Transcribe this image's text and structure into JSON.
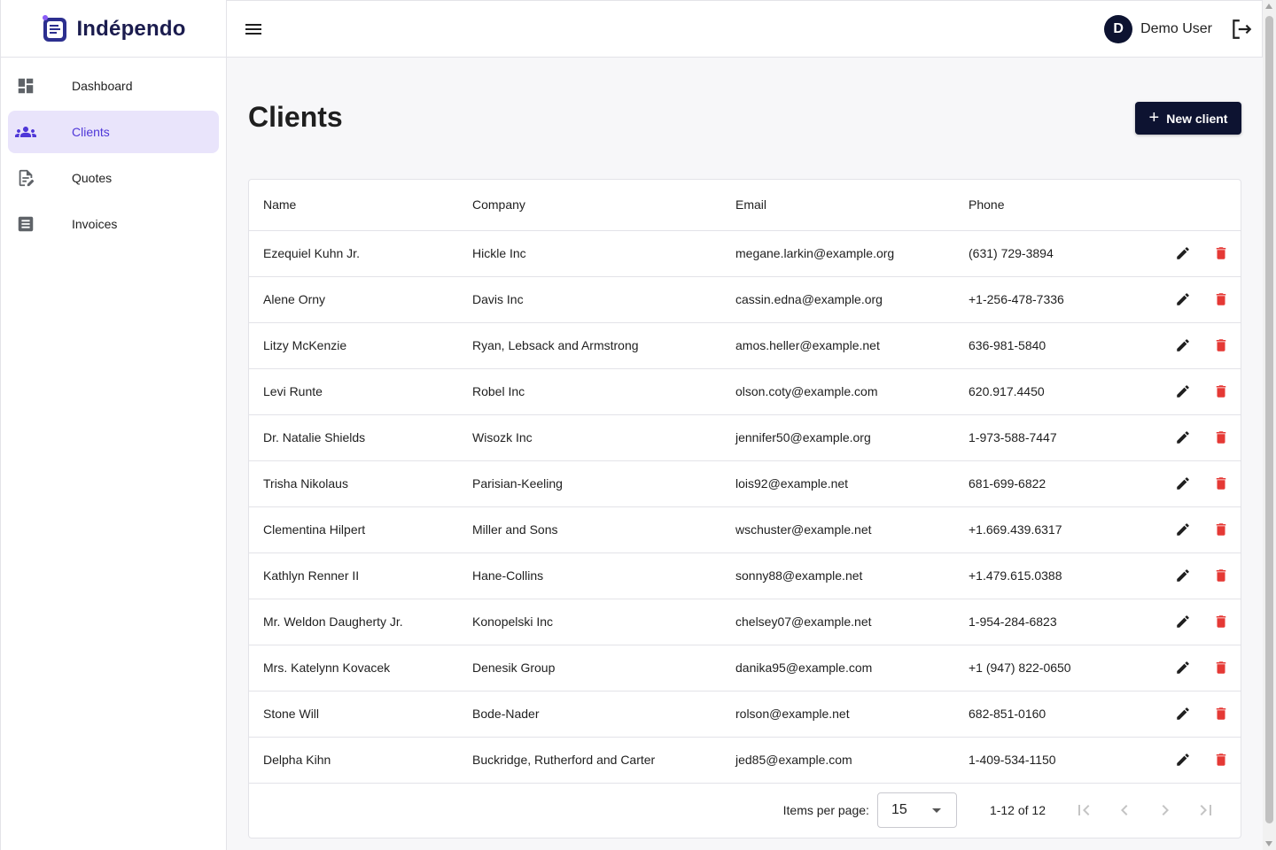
{
  "brand": {
    "name": "Indépendo"
  },
  "sidebar": {
    "items": [
      {
        "label": "Dashboard",
        "icon": "dashboard-icon",
        "active": false
      },
      {
        "label": "Clients",
        "icon": "people-icon",
        "active": true
      },
      {
        "label": "Quotes",
        "icon": "edit-document-icon",
        "active": false
      },
      {
        "label": "Invoices",
        "icon": "receipt-icon",
        "active": false
      }
    ]
  },
  "header": {
    "user": {
      "initial": "D",
      "name": "Demo User"
    }
  },
  "page": {
    "title": "Clients",
    "new_button_label": "New client"
  },
  "table": {
    "columns": [
      "Name",
      "Company",
      "Email",
      "Phone"
    ],
    "rows": [
      {
        "name": "Ezequiel Kuhn Jr.",
        "company": "Hickle Inc",
        "email": "megane.larkin@example.org",
        "phone": "(631) 729-3894"
      },
      {
        "name": "Alene Orny",
        "company": "Davis Inc",
        "email": "cassin.edna@example.org",
        "phone": "+1-256-478-7336"
      },
      {
        "name": "Litzy McKenzie",
        "company": "Ryan, Lebsack and Armstrong",
        "email": "amos.heller@example.net",
        "phone": "636-981-5840"
      },
      {
        "name": "Levi Runte",
        "company": "Robel Inc",
        "email": "olson.coty@example.com",
        "phone": "620.917.4450"
      },
      {
        "name": "Dr. Natalie Shields",
        "company": "Wisozk Inc",
        "email": "jennifer50@example.org",
        "phone": "1-973-588-7447"
      },
      {
        "name": "Trisha Nikolaus",
        "company": "Parisian-Keeling",
        "email": "lois92@example.net",
        "phone": "681-699-6822"
      },
      {
        "name": "Clementina Hilpert",
        "company": "Miller and Sons",
        "email": "wschuster@example.net",
        "phone": "+1.669.439.6317"
      },
      {
        "name": "Kathlyn Renner II",
        "company": "Hane-Collins",
        "email": "sonny88@example.net",
        "phone": "+1.479.615.0388"
      },
      {
        "name": "Mr. Weldon Daugherty Jr.",
        "company": "Konopelski Inc",
        "email": "chelsey07@example.net",
        "phone": "1-954-284-6823"
      },
      {
        "name": "Mrs. Katelynn Kovacek",
        "company": "Denesik Group",
        "email": "danika95@example.com",
        "phone": "+1 (947) 822-0650"
      },
      {
        "name": "Stone Will",
        "company": "Bode-Nader",
        "email": "rolson@example.net",
        "phone": "682-851-0160"
      },
      {
        "name": "Delpha Kihn",
        "company": "Buckridge, Rutherford and Carter",
        "email": "jed85@example.com",
        "phone": "1-409-534-1150"
      }
    ]
  },
  "pagination": {
    "items_per_page_label": "Items per page:",
    "items_per_page": "15",
    "range": "1-12 of 12"
  },
  "colors": {
    "primary": "#0d1331",
    "active_nav_bg": "#e9e4fb",
    "active_nav_text": "#4f37d8",
    "delete": "#e53935"
  }
}
